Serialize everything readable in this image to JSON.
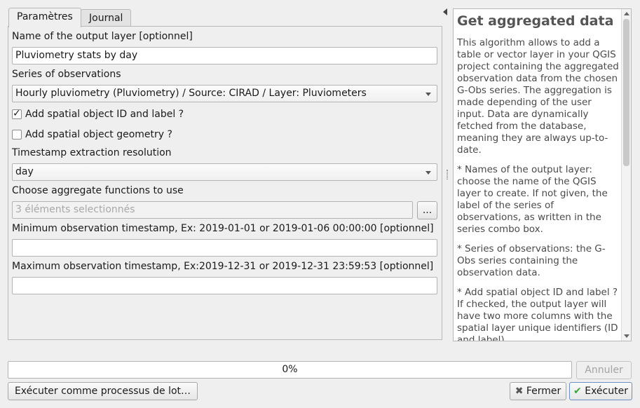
{
  "tabs": [
    {
      "label": "Paramètres"
    },
    {
      "label": "Journal"
    }
  ],
  "form": {
    "output_layer_label": "Name of the output layer [optionnel]",
    "output_layer_value": "Pluviometry stats by day",
    "series_label": "Series of observations",
    "series_value": "Hourly pluviometry  (Pluviometry) / Source: CIRAD / Layer: Pluviometers",
    "add_id_label": "Add spatial object ID and label ?",
    "add_id_checked": true,
    "add_geom_label": "Add spatial object geometry ?",
    "add_geom_checked": false,
    "resolution_label": "Timestamp extraction resolution",
    "resolution_value": "day",
    "aggregate_label": "Choose aggregate functions to use",
    "aggregate_value": "3 éléments selectionnés",
    "aggregate_button": "...",
    "min_ts_label": "Minimum observation timestamp, Ex: 2019-01-01 or 2019-01-06 00:00:00 [optionnel]",
    "min_ts_value": "",
    "max_ts_label": "Maximum observation timestamp, Ex:2019-12-31 or 2019-12-31 23:59:53 [optionnel]",
    "max_ts_value": ""
  },
  "help": {
    "title": "Get aggregated data",
    "paragraphs": [
      "This algorithm allows to add a table or vector layer in your QGIS project containing the aggregated observation data from the chosen G-Obs series. The aggregation is made depending of the user input. Data are dynamically fetched from the database, meaning they are always up-to-date.",
      "* Names of the output layer: choose the name of the QGIS layer to create. If not given, the label of the series of observations, as written in the series combo box.",
      "* Series of observations: the G-Obs series containing the observation data.",
      "* Add spatial object ID and label ? If checked, the output layer will have two more columns with the spatial layer unique identifiers (ID and label)."
    ]
  },
  "progress": {
    "text": "0%",
    "value": 0
  },
  "buttons": {
    "cancel": "Annuler",
    "batch": "Exécuter comme processus de lot…",
    "close": "Fermer",
    "run": "Exécuter"
  },
  "colors": {
    "run_icon": "#3aa63a",
    "close_icon": "#555555"
  }
}
